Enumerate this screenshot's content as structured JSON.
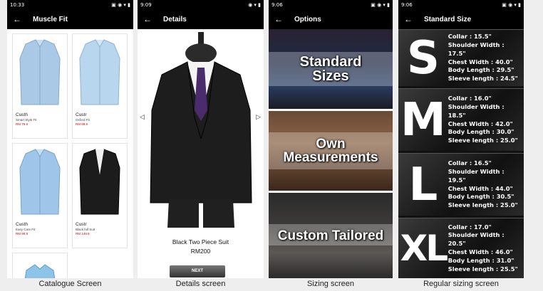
{
  "screens": {
    "catalogue": {
      "time": "10:33",
      "title": "Muscle Fit",
      "items": [
        {
          "name": "Custh",
          "desc": "Smart Style Fit",
          "price": "RM 79.9"
        },
        {
          "name": "Custr",
          "desc": "Oxford Fit",
          "price": "RM 89.9"
        },
        {
          "name": "Custh",
          "desc": "Easy Care Fit",
          "price": "RM 99.9"
        },
        {
          "name": "Custr",
          "desc": "Black full Suit",
          "price": "RM 149.9"
        }
      ],
      "caption": "Catalogue Screen"
    },
    "details": {
      "time": "9:09",
      "title": "Details",
      "product_name": "Black Two Piece Suit",
      "price": "RM200",
      "next_label": "NEXT",
      "caption": "Details screen"
    },
    "options": {
      "time": "9:06",
      "title": "Options",
      "items": [
        "Standard Sizes",
        "Own Measurements",
        "Custom Tailored"
      ],
      "caption": "Sizing screen"
    },
    "sizes": {
      "time": "9:06",
      "title": "Standard Size",
      "items": [
        {
          "letter": "S",
          "collar": "Collar : 15.5\"",
          "shoulder": "Shoulder Width : 17.5\"",
          "chest": "Chest Width : 40.0\"",
          "body": "Body Length : 29.5\"",
          "sleeve": "Sleeve length : 24.5\""
        },
        {
          "letter": "M",
          "collar": "Collar : 16.0\"",
          "shoulder": "Shoulder Width : 18.5\"",
          "chest": "Chest Width : 42.0\"",
          "body": "Body Length : 30.0\"",
          "sleeve": "Sleeve length : 25.0\""
        },
        {
          "letter": "L",
          "collar": "Collar : 16.5\"",
          "shoulder": "Shoulder Width : 19.5\"",
          "chest": "Chest Width : 44.0\"",
          "body": "Body Length : 30.5\"",
          "sleeve": "Sleeve length : 25.0\""
        },
        {
          "letter": "XL",
          "collar": "Collar : 17.0\"",
          "shoulder": "Shoulder Width : 20.5\"",
          "chest": "Chest Width : 46.0\"",
          "body": "Body Length : 31.0\"",
          "sleeve": "Sleeve length : 25.5\""
        }
      ],
      "caption": "Regular sizing screen"
    }
  },
  "colors": {
    "appbar": "#000000",
    "price_red": "#dd0000"
  }
}
